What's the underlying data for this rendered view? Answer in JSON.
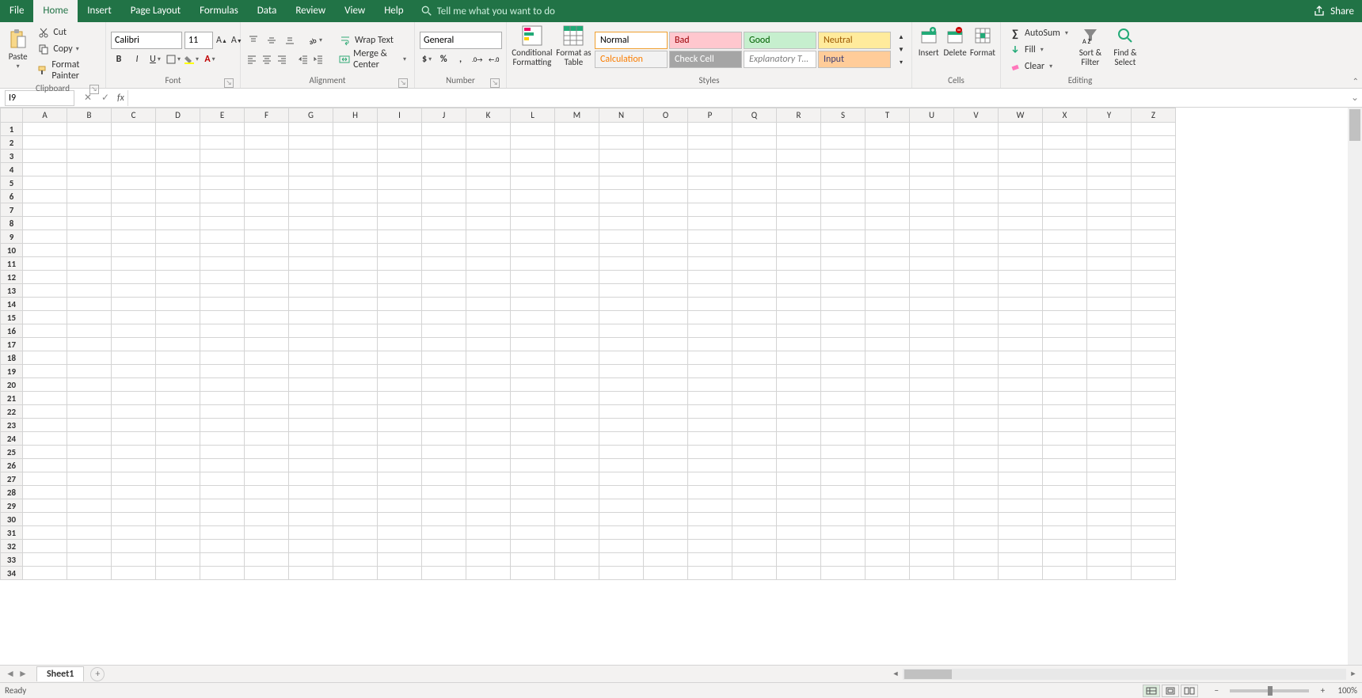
{
  "tabs": {
    "file": "File",
    "home": "Home",
    "insert": "Insert",
    "pagelayout": "Page Layout",
    "formulas": "Formulas",
    "data": "Data",
    "review": "Review",
    "view": "View",
    "help": "Help"
  },
  "tellme_placeholder": "Tell me what you want to do",
  "share": "Share",
  "clipboard": {
    "paste": "Paste",
    "cut": "Cut",
    "copy": "Copy",
    "format_painter": "Format Painter",
    "group": "Clipboard"
  },
  "font": {
    "name": "Calibri",
    "size": "11",
    "group": "Font"
  },
  "alignment": {
    "wrap": "Wrap Text",
    "merge": "Merge & Center",
    "group": "Alignment"
  },
  "number": {
    "format": "General",
    "group": "Number"
  },
  "styles": {
    "cond_fmt": "Conditional Formatting",
    "fmt_table": "Format as Table",
    "cells": [
      {
        "label": "Normal",
        "bg": "#ffffff",
        "fg": "#000000",
        "fs": "normal"
      },
      {
        "label": "Bad",
        "bg": "#ffc7ce",
        "fg": "#9c0006",
        "fs": "normal"
      },
      {
        "label": "Good",
        "bg": "#c6efce",
        "fg": "#006100",
        "fs": "normal"
      },
      {
        "label": "Neutral",
        "bg": "#ffeb9c",
        "fg": "#9c5700",
        "fs": "normal"
      },
      {
        "label": "Calculation",
        "bg": "#f2f2f2",
        "fg": "#fa7d00",
        "fs": "normal"
      },
      {
        "label": "Check Cell",
        "bg": "#a5a5a5",
        "fg": "#ffffff",
        "fs": "normal"
      },
      {
        "label": "Explanatory T…",
        "bg": "#ffffff",
        "fg": "#7f7f7f",
        "fs": "italic"
      },
      {
        "label": "Input",
        "bg": "#ffcc99",
        "fg": "#3f3f76",
        "fs": "normal"
      }
    ],
    "group": "Styles"
  },
  "cells": {
    "insert": "Insert",
    "delete": "Delete",
    "format": "Format",
    "group": "Cells"
  },
  "editing": {
    "autosum": "AutoSum",
    "fill": "Fill",
    "clear": "Clear",
    "sort_filter": "Sort & Filter",
    "find_select": "Find & Select",
    "group": "Editing"
  },
  "namebox": "I9",
  "formula": "",
  "columns": [
    "A",
    "B",
    "C",
    "D",
    "E",
    "F",
    "G",
    "H",
    "I",
    "J",
    "K",
    "L",
    "M",
    "N",
    "O",
    "P",
    "Q",
    "R",
    "S",
    "T",
    "U",
    "V",
    "W",
    "X",
    "Y",
    "Z"
  ],
  "row_start": 1,
  "row_end": 34,
  "sheet_tab": "Sheet1",
  "status": "Ready",
  "zoom": "100%"
}
